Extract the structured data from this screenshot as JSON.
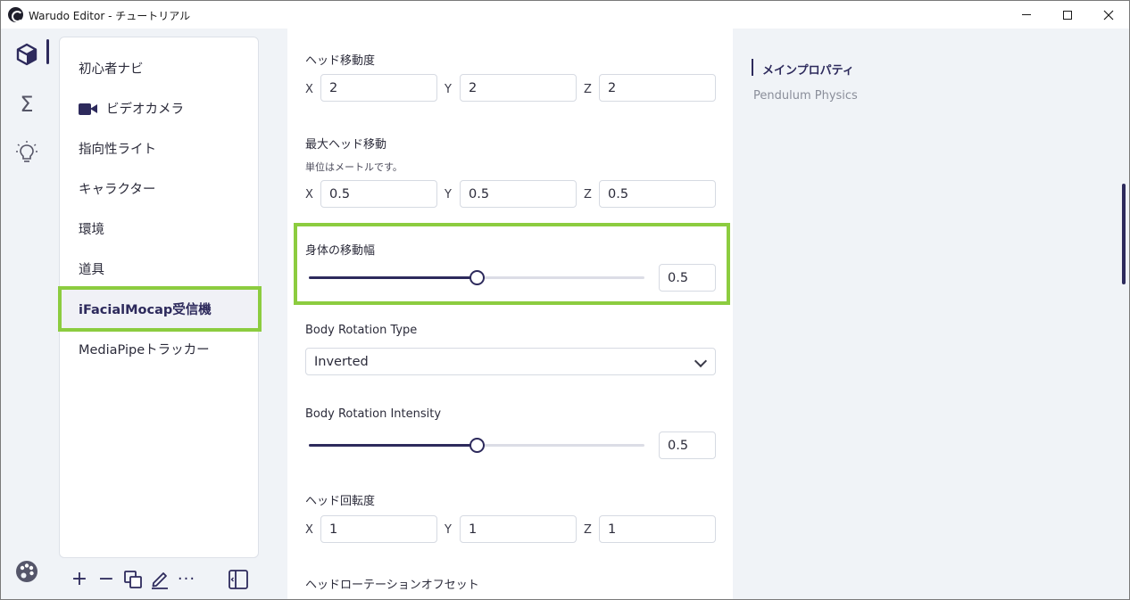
{
  "window": {
    "title": "Warudo Editor - チュートリアル"
  },
  "activity_bar": {
    "items": [
      {
        "icon": "cube-icon",
        "active": true
      },
      {
        "icon": "sigma-icon",
        "label": "Σ"
      },
      {
        "icon": "lightbulb-icon"
      }
    ],
    "bottom_icon": "palette-icon"
  },
  "nodes": {
    "items": [
      {
        "label": "初心者ナビ"
      },
      {
        "label": "ビデオカメラ",
        "icon": "video-camera-icon"
      },
      {
        "label": "指向性ライト"
      },
      {
        "label": "キャラクター"
      },
      {
        "label": "環境"
      },
      {
        "label": "道具"
      },
      {
        "label": "iFacialMocap受信機",
        "selected": true
      },
      {
        "label": "MediaPipeトラッカー"
      }
    ]
  },
  "toolbar": {
    "add": "+",
    "remove": "−",
    "more": "···"
  },
  "properties": {
    "head_movement": {
      "label": "ヘッド移動度",
      "x_label": "X",
      "x": "2",
      "y_label": "Y",
      "y": "2",
      "z_label": "Z",
      "z": "2"
    },
    "max_head_movement": {
      "label": "最大ヘッド移動",
      "description": "単位はメートルです。",
      "x_label": "X",
      "x": "0.5",
      "y_label": "Y",
      "y": "0.5",
      "z_label": "Z",
      "z": "0.5"
    },
    "body_movement_range": {
      "label": "身体の移動幅",
      "value": "0.5",
      "fraction": 0.5
    },
    "body_rotation_type": {
      "label": "Body Rotation Type",
      "value": "Inverted"
    },
    "body_rotation_intensity": {
      "label": "Body Rotation Intensity",
      "value": "0.5",
      "fraction": 0.5
    },
    "head_rotation": {
      "label": "ヘッド回転度",
      "x_label": "X",
      "x": "1",
      "y_label": "Y",
      "y": "1",
      "z_label": "Z",
      "z": "1"
    },
    "head_rotation_offset": {
      "label": "ヘッドローテーションオフセット"
    }
  },
  "outline": {
    "main": "メインプロパティ",
    "sub": "Pendulum Physics"
  },
  "colors": {
    "accent": "#2d2a5c",
    "highlight": "#8ccc3f",
    "panel_bg": "#f0f3f7"
  }
}
